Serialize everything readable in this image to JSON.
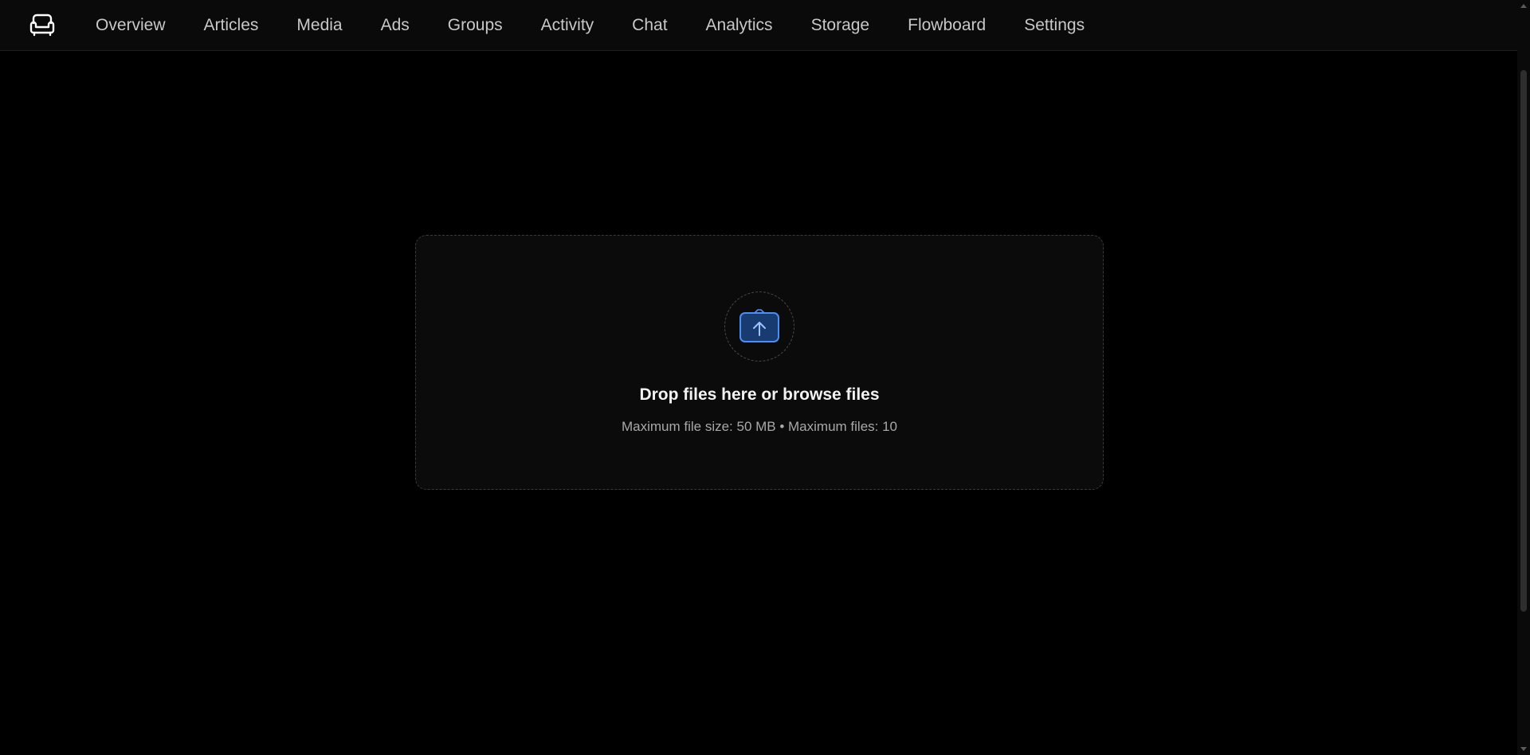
{
  "header": {
    "logo_icon": "sofa-icon",
    "nav": [
      {
        "label": "Overview"
      },
      {
        "label": "Articles"
      },
      {
        "label": "Media"
      },
      {
        "label": "Ads"
      },
      {
        "label": "Groups"
      },
      {
        "label": "Activity"
      },
      {
        "label": "Chat"
      },
      {
        "label": "Analytics"
      },
      {
        "label": "Storage"
      },
      {
        "label": "Flowboard"
      },
      {
        "label": "Settings"
      }
    ]
  },
  "dropzone": {
    "icon": "folder-upload-icon",
    "title": "Drop files here or browse files",
    "subtitle": "Maximum file size: 50 MB • Maximum files: 10",
    "accent_color": "#4a8ff5"
  }
}
